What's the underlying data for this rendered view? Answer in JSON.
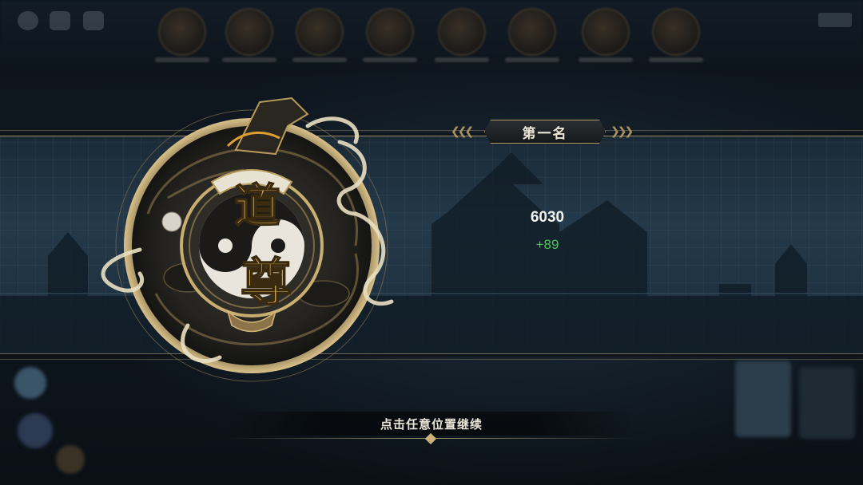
{
  "result": {
    "rank_label": "第一名",
    "score": "6030",
    "score_delta": "+89",
    "emblem_title": "道尊"
  },
  "prompt": {
    "continue_text": "点击任意位置继续"
  },
  "colors": {
    "accent_gold": "#cbb27a",
    "delta_green": "#4fc05a",
    "banner_blue": "#24394a"
  },
  "icons": [
    "settings-icon",
    "chat-icon",
    "mail-icon",
    "taiji-icon",
    "dragon-emblem"
  ]
}
